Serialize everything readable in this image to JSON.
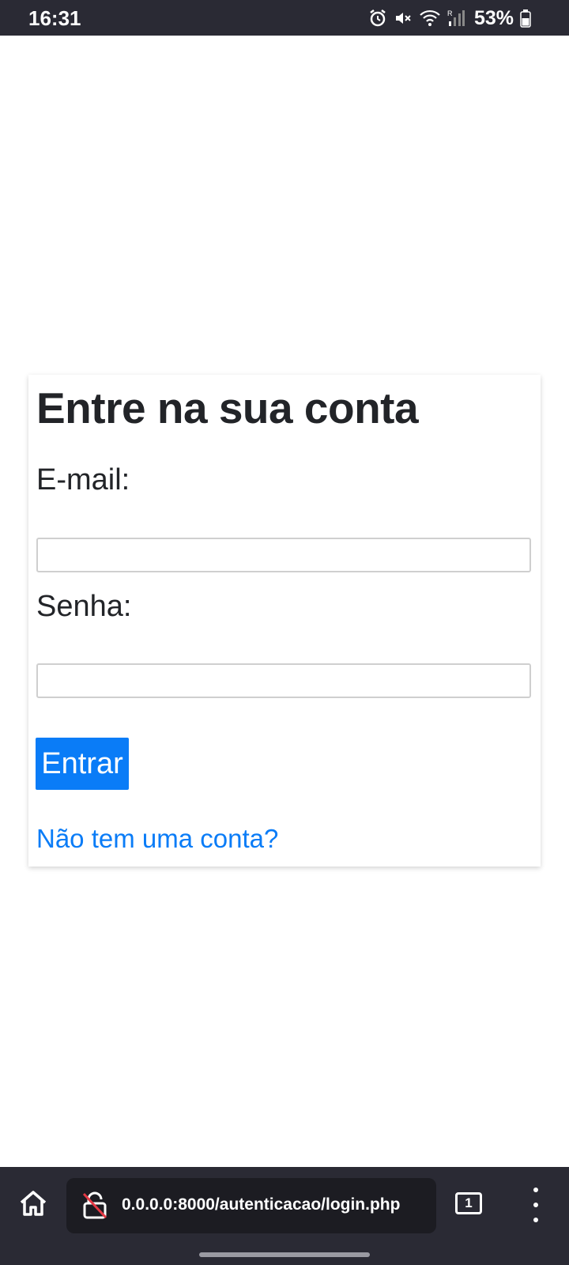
{
  "status_bar": {
    "time": "16:31",
    "battery": "53%",
    "icons": [
      "alarm-icon",
      "mute-icon",
      "wifi-icon",
      "signal-icon",
      "battery-icon"
    ]
  },
  "login": {
    "title": "Entre na sua conta",
    "email_label": "E-mail:",
    "email_value": "",
    "password_label": "Senha:",
    "password_value": "",
    "submit_label": "Entrar",
    "signup_link": "Não tem uma conta?"
  },
  "browser": {
    "url": "0.0.0.0:8000/autenticacao/login.php",
    "tab_count": "1",
    "icons": [
      "home-icon",
      "insecure-lock-icon",
      "tabs-icon",
      "more-vert-icon"
    ]
  },
  "colors": {
    "accent": "#0a7cf7",
    "bar_background": "#2a2a34",
    "text": "#222428"
  }
}
